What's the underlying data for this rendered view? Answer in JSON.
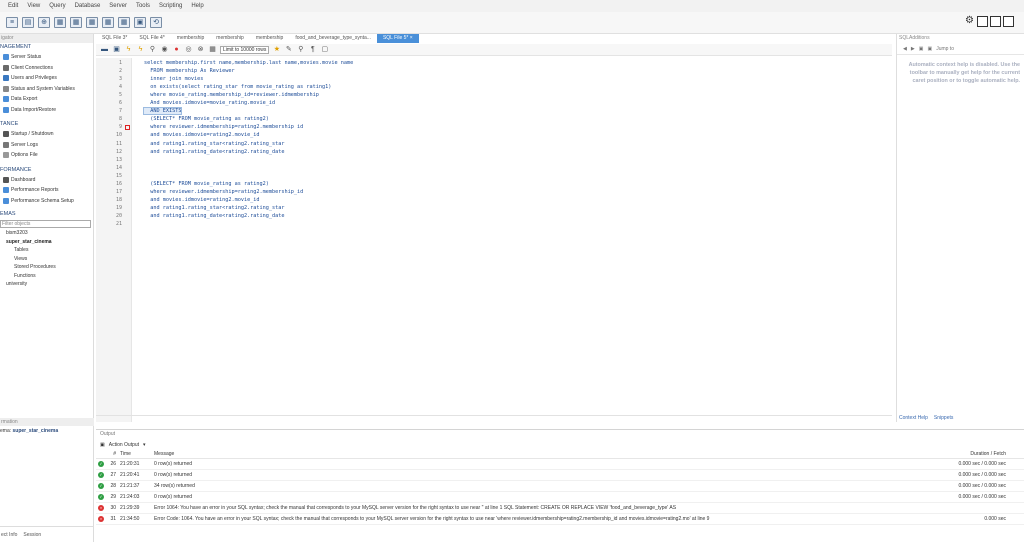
{
  "menu": [
    "Edit",
    "View",
    "Query",
    "Database",
    "Server",
    "Tools",
    "Scripting",
    "Help"
  ],
  "sidebar": {
    "header": "igator",
    "management_label": "NAGEMENT",
    "management_items": [
      "Server Status",
      "Client Connections",
      "Users and Privileges",
      "Status and System Variables",
      "Data Export",
      "Data Import/Restore"
    ],
    "instance_label": "TANCE",
    "instance_items": [
      "Startup / Shutdown",
      "Server Logs",
      "Options File"
    ],
    "performance_label": "FORMANCE",
    "performance_items": [
      "Dashboard",
      "Performance Reports",
      "Performance Schema Setup"
    ],
    "schemas_label": "EMAS",
    "filter_placeholder": "Filter objects",
    "tree": [
      "bism3203",
      "super_star_cinema",
      "Tables",
      "Views",
      "Stored Procedures",
      "Functions",
      "university"
    ],
    "info_label": "rmation",
    "schema_prefix": "ema:",
    "schema_name": "super_star_cinema",
    "bottom_tabs": [
      "ect Info",
      "Session"
    ]
  },
  "tabs": [
    "SQL File 3*",
    "SQL File 4*",
    "membership",
    "membership",
    "membership",
    "food_and_beverage_type_synta...",
    "SQL File 5*"
  ],
  "editor": {
    "limit_label": "Limit to 10000 rows",
    "lines": [
      {
        "n": "1",
        "text": "select membership.first name,membership.last name,movies.movie name"
      },
      {
        "n": "2",
        "text": "  FROM membership As Reviewer"
      },
      {
        "n": "3",
        "text": "  inner join movies"
      },
      {
        "n": "4",
        "text": "  on exists(select rating_star from movie_rating as rating1)"
      },
      {
        "n": "5",
        "text": "  where movie_rating.membership_id=reviewer.idmembership"
      },
      {
        "n": "6",
        "text": "  And movies.idmovie=movie_rating.movie_id"
      },
      {
        "n": "7",
        "text": "  AND EXISTS"
      },
      {
        "n": "8",
        "text": "  (SELECT* FROM movie_rating as rating2)"
      },
      {
        "n": "9",
        "text": "  where reviewer.idmembership=rating2.membership id"
      },
      {
        "n": "10",
        "text": "  and movies.idmovie=rating2.movie_id"
      },
      {
        "n": "11",
        "text": "  and rating1.rating_star<rating2.rating_star"
      },
      {
        "n": "12",
        "text": "  and rating1.rating_date<rating2.rating_date"
      },
      {
        "n": "13",
        "text": ""
      },
      {
        "n": "14",
        "text": ""
      },
      {
        "n": "15",
        "text": ""
      },
      {
        "n": "16",
        "text": "  (SELECT* FROM movie_rating as rating2)"
      },
      {
        "n": "17",
        "text": "  where reviewer.idmembership=rating2.membership_id"
      },
      {
        "n": "18",
        "text": "  and movies.idmovie=rating2.movie_id"
      },
      {
        "n": "19",
        "text": "  and rating1.rating_star<rating2.rating_star"
      },
      {
        "n": "20",
        "text": "  and rating1.rating_date<rating2.rating_date"
      },
      {
        "n": "21",
        "text": ""
      }
    ]
  },
  "right_panel": {
    "title": "SQLAdditions",
    "jump_label": "Jump to",
    "help_text": "Automatic context help is disabled. Use the toolbar to manually get help for the current caret position or to toggle automatic help.",
    "tabs": [
      "Context Help",
      "Snippets"
    ]
  },
  "output": {
    "title": "Output",
    "selector": "Action Output",
    "headers": {
      "num": "#",
      "time": "Time",
      "message": "Message",
      "duration": "Duration / Fetch"
    },
    "rows": [
      {
        "status": "ok",
        "num": "26",
        "time": "21:20:31",
        "message": "0 row(s) returned",
        "duration": "0.000 sec / 0.000 sec"
      },
      {
        "status": "ok",
        "num": "27",
        "time": "21:20:41",
        "message": "0 row(s) returned",
        "duration": "0.000 sec / 0.000 sec"
      },
      {
        "status": "ok",
        "num": "28",
        "time": "21:21:37",
        "message": "34 row(s) returned",
        "duration": "0.000 sec / 0.000 sec"
      },
      {
        "status": "ok",
        "num": "29",
        "time": "21:24:03",
        "message": "0 row(s) returned",
        "duration": "0.000 sec / 0.000 sec"
      },
      {
        "status": "error",
        "num": "30",
        "time": "21:29:39",
        "message": "Error 1064: You have an error in your SQL syntax; check the manual that corresponds to your MySQL server version for the right syntax to use near '' at line 1 SQL Statement: CREATE OR REPLACE VIEW 'food_and_beverage_type' AS",
        "duration": ""
      },
      {
        "status": "error",
        "num": "31",
        "time": "21:34:50",
        "message": "Error Code: 1064. You have an error in your SQL syntax; check the manual that corresponds to your MySQL server version for the right syntax to use near 'where reviewer.idmembership=rating2.membership_id and movies.idmovie=rating2.mo' at line 9",
        "duration": "0.000 sec"
      }
    ]
  }
}
